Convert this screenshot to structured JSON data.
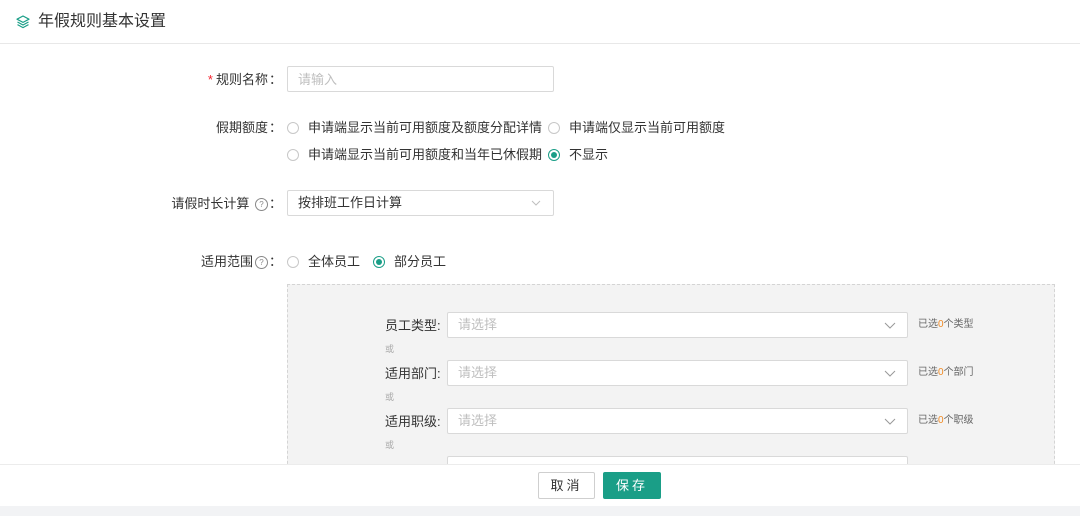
{
  "header": {
    "title": "年假规则基本设置",
    "icon": "layers-icon"
  },
  "form": {
    "rule_name": {
      "required_mark": "*",
      "label": "规则名称",
      "colon": "：",
      "placeholder": "请输入",
      "value": ""
    },
    "quota": {
      "label": "假期额度",
      "colon": "：",
      "options": [
        {
          "label": "申请端显示当前可用额度及额度分配详情",
          "checked": false
        },
        {
          "label": "申请端仅显示当前可用额度",
          "checked": false
        },
        {
          "label": "申请端显示当前可用额度和当年已休假期",
          "checked": false
        },
        {
          "label": "不显示",
          "checked": true
        }
      ]
    },
    "duration": {
      "label": "请假时长计算",
      "help_icon_text": "?",
      "colon": "：",
      "selected": "按排班工作日计算"
    },
    "scope": {
      "label": "适用范围",
      "help_icon_text": "?",
      "colon": "：",
      "options": [
        {
          "label": "全体员工",
          "checked": false
        },
        {
          "label": "部分员工",
          "checked": true
        }
      ]
    },
    "scope_panel": {
      "or_text": "或",
      "rows": [
        {
          "label": "员工类型",
          "colon": ":",
          "placeholder": "请选择",
          "hint_prefix": "已选",
          "hint_count": "0",
          "hint_suffix": "个类型"
        },
        {
          "label": "适用部门",
          "colon": ":",
          "placeholder": "请选择",
          "hint_prefix": "已选",
          "hint_count": "0",
          "hint_suffix": "个部门"
        },
        {
          "label": "适用职级",
          "colon": ":",
          "placeholder": "请选择",
          "hint_prefix": "已选",
          "hint_count": "0",
          "hint_suffix": "个职级"
        }
      ]
    }
  },
  "footer": {
    "cancel_label": "取消",
    "save_label": "保存"
  },
  "colors": {
    "accent": "#1a9e87",
    "required": "#f5222d",
    "count": "#f08a24"
  }
}
